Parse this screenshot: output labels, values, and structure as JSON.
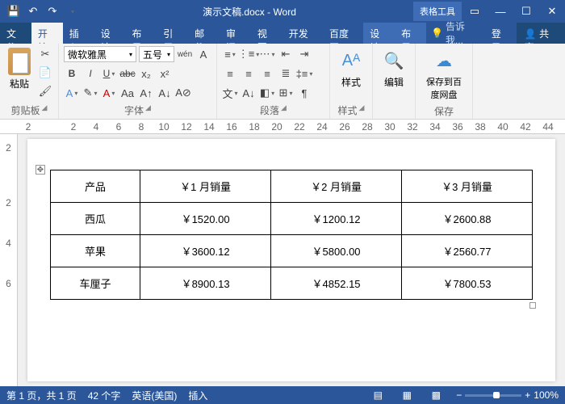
{
  "titlebar": {
    "doc_title": "演示文稿.docx - Word",
    "table_tools": "表格工具"
  },
  "tabs": {
    "file": "文件",
    "home": "开始",
    "insert": "插入",
    "design": "设计",
    "layout": "布局",
    "references": "引用",
    "mail": "邮件",
    "review": "审阅",
    "view": "视图",
    "developer": "开发工",
    "baidu": "百度网",
    "tdesign": "设计",
    "tlayout": "布局",
    "tell": "告诉我...",
    "login": "登录",
    "share": "共享"
  },
  "ribbon": {
    "clipboard": {
      "paste": "粘贴",
      "label": "剪贴板"
    },
    "font": {
      "name": "微软雅黑",
      "size": "五号",
      "label": "字体"
    },
    "paragraph": {
      "label": "段落"
    },
    "styles": {
      "btn": "样式",
      "label": "样式"
    },
    "editing": {
      "btn": "编辑"
    },
    "save": {
      "btn": "保存到百度网盘",
      "label": "保存"
    }
  },
  "ruler_h": [
    "2",
    "",
    "2",
    "4",
    "6",
    "8",
    "10",
    "12",
    "14",
    "16",
    "18",
    "20",
    "22",
    "24",
    "26",
    "28",
    "30",
    "32",
    "34",
    "36",
    "38",
    "40",
    "42",
    "44"
  ],
  "ruler_v": [
    "2",
    "",
    "",
    "2",
    "",
    "4",
    "",
    "6"
  ],
  "table": {
    "headers": [
      "产品",
      "￥1 月销量",
      "￥2 月销量",
      "￥3 月销量"
    ],
    "rows": [
      [
        "西瓜",
        "￥1520.00",
        "￥1200.12",
        "￥2600.88"
      ],
      [
        "苹果",
        "￥3600.12",
        "￥5800.00",
        "￥2560.77"
      ],
      [
        "车厘子",
        "￥8900.13",
        "￥4852.15",
        "￥7800.53"
      ]
    ]
  },
  "status": {
    "page": "第 1 页，共 1 页",
    "words": "42 个字",
    "lang": "英语(美国)",
    "mode": "插入",
    "zoom": "100%"
  }
}
